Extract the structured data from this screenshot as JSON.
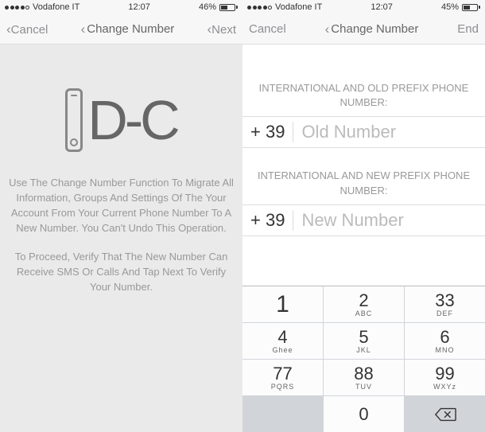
{
  "left": {
    "status": {
      "carrier": "Vodafone IT",
      "time": "12:07",
      "battery_pct": "46%",
      "battery_fill": 46
    },
    "nav": {
      "back": "Cancel",
      "title": "Change Number",
      "next": "Next"
    },
    "graphic_text": "D-C",
    "info1": "Use The Change Number Function To Migrate All Information, Groups And Settings Of The Your Account From Your Current Phone Number To A New Number. You Can't Undo This Operation.",
    "info2": "To Proceed, Verify That The New Number Can Receive SMS Or Calls And Tap Next To Verify Your Number."
  },
  "right": {
    "status": {
      "carrier": "Vodafone IT",
      "time": "12:07",
      "battery_pct": "45%",
      "battery_fill": 45
    },
    "nav": {
      "back": "Cancel",
      "title": "Change Number",
      "next": "End"
    },
    "field1": {
      "label": "INTERNATIONAL AND OLD PREFIX PHONE NUMBER:",
      "prefix": "+ 39",
      "placeholder": "Old Number"
    },
    "field2": {
      "label": "INTERNATIONAL AND NEW PREFIX PHONE NUMBER:",
      "prefix": "+ 39",
      "placeholder": "New Number"
    },
    "keypad": [
      {
        "digit": "1",
        "letters": ""
      },
      {
        "digit": "2",
        "letters": "ABC"
      },
      {
        "digit": "33",
        "letters": "DEF"
      },
      {
        "digit": "4",
        "letters": "Ghee"
      },
      {
        "digit": "5",
        "letters": "JKL"
      },
      {
        "digit": "6",
        "letters": "MNO"
      },
      {
        "digit": "77",
        "letters": "PQRS"
      },
      {
        "digit": "88",
        "letters": "TUV"
      },
      {
        "digit": "99",
        "letters": "WXYz"
      },
      {
        "digit": "",
        "letters": ""
      },
      {
        "digit": "0",
        "letters": ""
      },
      {
        "digit": "⌫",
        "letters": ""
      }
    ]
  }
}
